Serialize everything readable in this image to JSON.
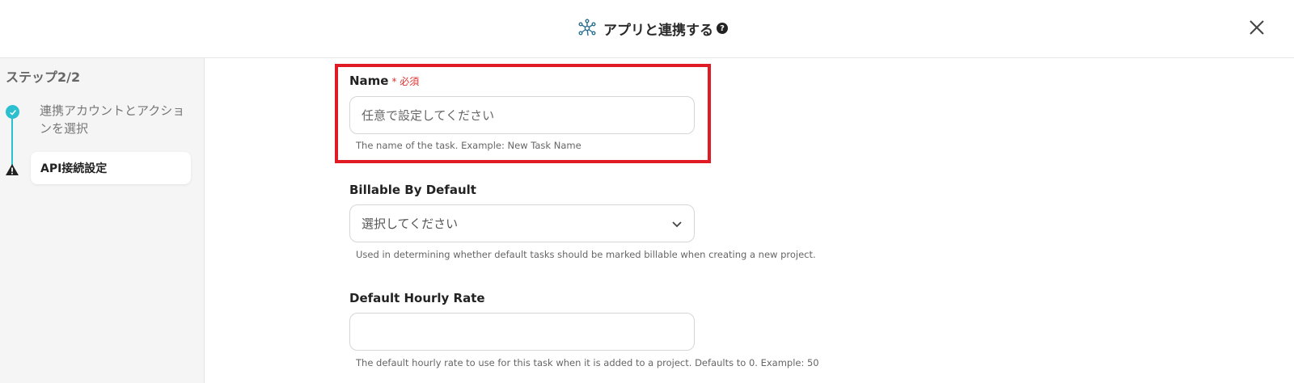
{
  "header": {
    "title": "アプリと連携する",
    "help_glyph": "?",
    "hub_icon": "hub-network-icon",
    "close_icon": "close-icon"
  },
  "sidebar": {
    "step_label": "ステップ2/2",
    "steps": [
      {
        "label": "連携アカウントとアクションを選択",
        "status": "complete"
      },
      {
        "label": "API接続設定",
        "status": "warning"
      }
    ]
  },
  "form": {
    "name": {
      "label": "Name",
      "required_mark": "* 必須",
      "placeholder": "任意で設定してください",
      "help": "The name of the task. Example: New Task Name"
    },
    "billable": {
      "label": "Billable By Default",
      "selected": "選択してください",
      "help": "Used in determining whether default tasks should be marked billable when creating a new project."
    },
    "hourly_rate": {
      "label": "Default Hourly Rate",
      "value": "",
      "help": "The default hourly rate to use for this task when it is added to a project. Defaults to 0. Example: 50"
    }
  },
  "colors": {
    "accent": "#2bbfcf",
    "required": "#e03030",
    "highlight": "#e01b24"
  }
}
